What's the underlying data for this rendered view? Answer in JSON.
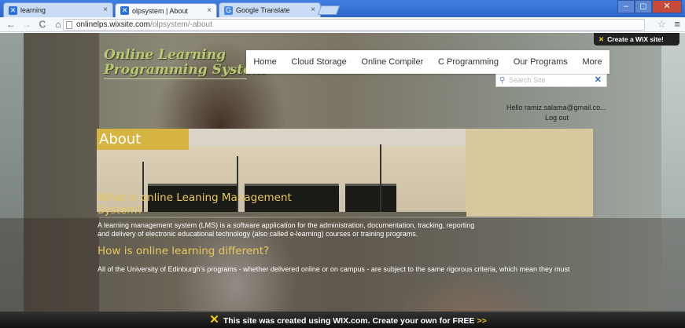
{
  "browser": {
    "tabs": [
      {
        "title": "learning",
        "active": false
      },
      {
        "title": "olpsystem | About",
        "active": true
      },
      {
        "title": "Google Translate",
        "active": false
      }
    ],
    "window_buttons": {
      "minimize": "–",
      "maximize": "◻",
      "close": "✕"
    },
    "address": {
      "domain": "onlinelps.wixsite.com",
      "path": "/olpsystem/-about"
    }
  },
  "site": {
    "logo_line1": "Online Learning",
    "logo_line2": "Programming System",
    "nav": [
      "Home",
      "Cloud Storage",
      "Online Compiler",
      "C Programming",
      "Our Programs",
      "More"
    ],
    "wix_badge": "Create a WiX site!",
    "search_placeholder": "Search Site",
    "user_greeting": "Hello ramiz.salama@gmail.co...",
    "logout": "Log out",
    "about_title": "About",
    "heading1": "What is online Leaning Management System?",
    "paragraph1": "A learning management system (LMS) is a software application for the administration, documentation, tracking, reporting and delivery of electronic educational technology (also called e-learning) courses or training programs.",
    "heading2": "How is online learning different?",
    "paragraph2": "All of the University of Edinburgh's programs - whether delivered online or on campus - are subject to the same rigorous criteria, which mean they must",
    "wix_footer": "This site was created using WIX.com. Create your own for FREE",
    "wix_footer_arrow": ">>"
  },
  "colors": {
    "accent": "#d6b441",
    "heading": "#e9c95b",
    "wix_yellow": "#f4d000"
  }
}
